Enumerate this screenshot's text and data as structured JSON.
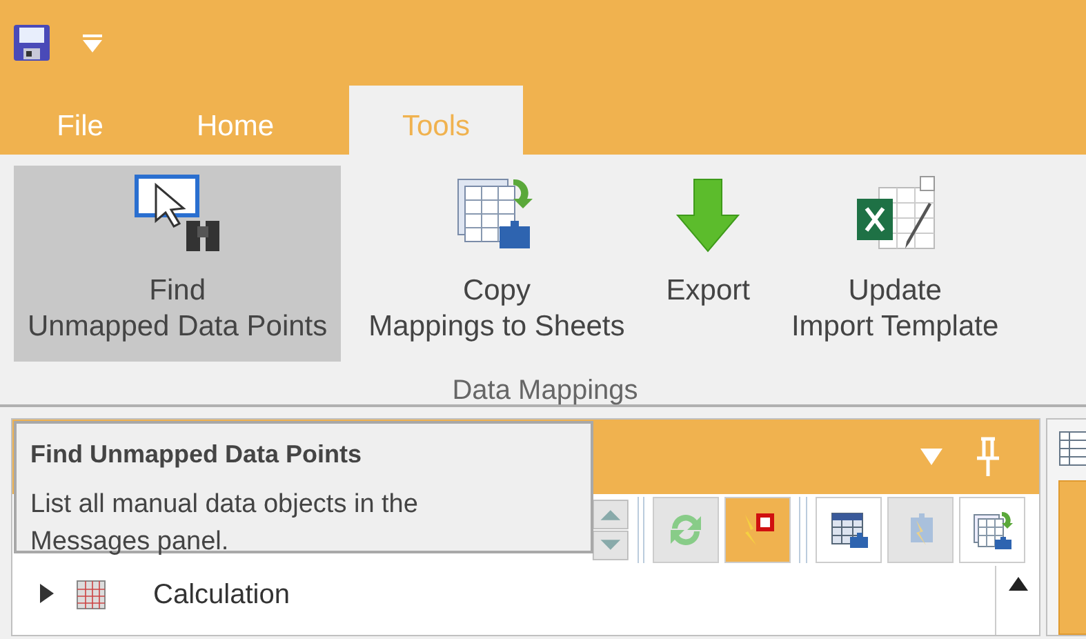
{
  "tabs": [
    {
      "label": "File",
      "selected": false
    },
    {
      "label": "Home",
      "selected": false
    },
    {
      "label": "Tools",
      "selected": true
    }
  ],
  "ribbon": {
    "groups": [
      {
        "label": "Data Mappings",
        "buttons": [
          {
            "kind": "find",
            "lines": [
              "Find",
              "Unmapped Data Points"
            ],
            "highlighted": true
          },
          {
            "kind": "copy",
            "lines": [
              "Copy",
              "Mappings to Sheets"
            ],
            "highlighted": false
          },
          {
            "kind": "export",
            "lines": [
              "Export"
            ],
            "highlighted": false
          },
          {
            "kind": "update",
            "lines": [
              "Update",
              "Import Template"
            ],
            "highlighted": false
          }
        ]
      }
    ]
  },
  "panel": {
    "toolbar": [
      {
        "kind": "spin"
      },
      {
        "kind": "refresh",
        "disabled": true,
        "active": false
      },
      {
        "kind": "flag",
        "disabled": false,
        "active": true
      },
      {
        "kind": "table",
        "disabled": false,
        "active": false
      },
      {
        "kind": "puzzle",
        "disabled": true,
        "active": false
      },
      {
        "kind": "copy",
        "disabled": false,
        "active": false
      }
    ],
    "tree": [
      {
        "label": "Calculation",
        "expanded": false
      }
    ]
  },
  "tooltip": {
    "title": "Find Unmapped Data Points",
    "text": "List all manual data objects in the Messages panel."
  }
}
